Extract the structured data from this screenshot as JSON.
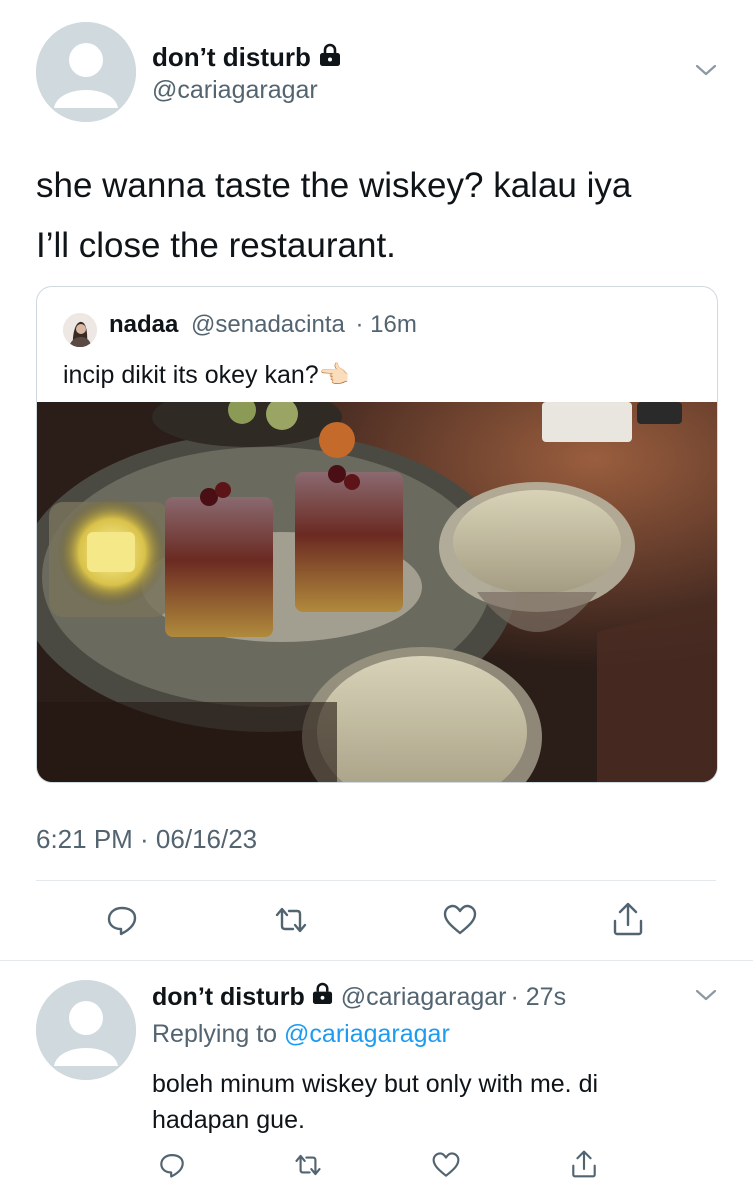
{
  "tweet": {
    "display_name": "don’t disturb",
    "handle": "@cariagaragar",
    "text_line1": "she wanna taste the wiskey? kalau iya",
    "text_line2": "I’ll close the restaurant.",
    "quoted": {
      "display_name": "nadaa",
      "handle": "@senadacinta",
      "time": "· 16m",
      "text": "incip dikit its okey kan?👈🏻"
    },
    "timestamp": "6:21 PM · 06/16/23"
  },
  "reply": {
    "display_name": "don’t disturb",
    "handle": "@cariagaragar",
    "time": "· 27s",
    "replying_prefix": "Replying to ",
    "replying_to": "@cariagaragar",
    "text_line1": "boleh minum wiskey but only with me. di",
    "text_line2": "hadapan gue."
  },
  "icons": {
    "lock": "lock-icon",
    "chevron": "chevron-down-icon",
    "reply": "reply-icon",
    "retweet": "retweet-icon",
    "like": "heart-icon",
    "share": "share-icon"
  },
  "colors": {
    "link": "#1d9bf0",
    "muted": "#536471",
    "avatar": "#cfd9de"
  }
}
